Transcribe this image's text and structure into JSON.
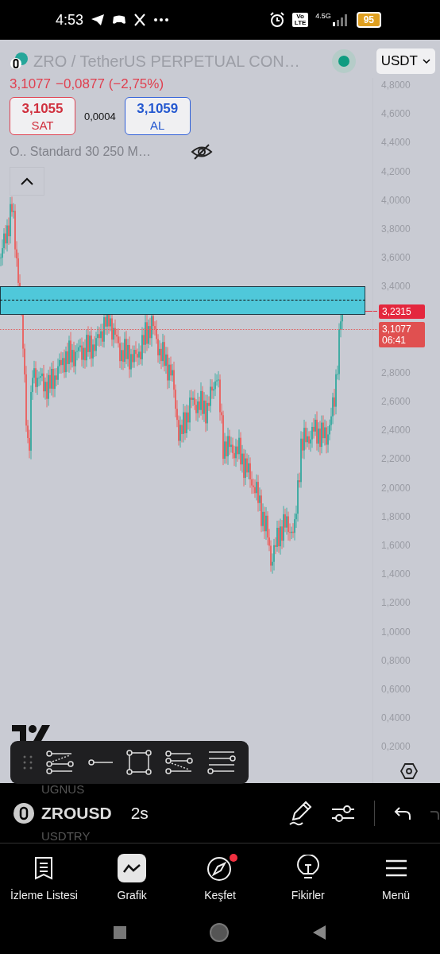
{
  "status_bar": {
    "time": "4:53",
    "volte": "Vo LTE",
    "network": "4.5G",
    "battery": "95"
  },
  "header": {
    "title": "ZRO / TetherUS PERPETUAL CON…",
    "live": true,
    "currency": "USDT",
    "price": "3,1077",
    "change": "−0,0877 (−2,75%)",
    "sell": {
      "price": "3,1055",
      "label": "SAT"
    },
    "spread": "0,0004",
    "buy": {
      "price": "3,1059",
      "label": "AL"
    },
    "indicator": "O.. Standard 30 250 M…"
  },
  "price_axis": [
    "4,8000",
    "4,6000",
    "4,4000",
    "4,2000",
    "4,0000",
    "3,8000",
    "3,6000",
    "3,4000",
    "2,8000",
    "2,6000",
    "2,4000",
    "2,2000",
    "2,0000",
    "1,8000",
    "1,6000",
    "1,4000",
    "1,2000",
    "1,0000",
    "0,8000",
    "0,6000",
    "0,4000",
    "0,2000"
  ],
  "price_tags": [
    {
      "value": "3,2315",
      "kind": "alert"
    },
    {
      "value": "3,1077",
      "countdown": "06:41",
      "kind": "last"
    }
  ],
  "bottom_bar": {
    "previous_symbol": "UGNUS",
    "symbol": "ZROUSD",
    "next_symbol": "USDTRY",
    "interval": "2s"
  },
  "nav": [
    {
      "label": "İzleme Listesi",
      "selected": false,
      "badge": false,
      "kind": "list"
    },
    {
      "label": "Grafik",
      "selected": true,
      "badge": false,
      "kind": "chart"
    },
    {
      "label": "Keşfet",
      "selected": false,
      "badge": true,
      "kind": "compass"
    },
    {
      "label": "Fikirler",
      "selected": false,
      "badge": false,
      "kind": "bulb"
    },
    {
      "label": "Menü",
      "selected": false,
      "badge": false,
      "kind": "menu"
    }
  ]
}
